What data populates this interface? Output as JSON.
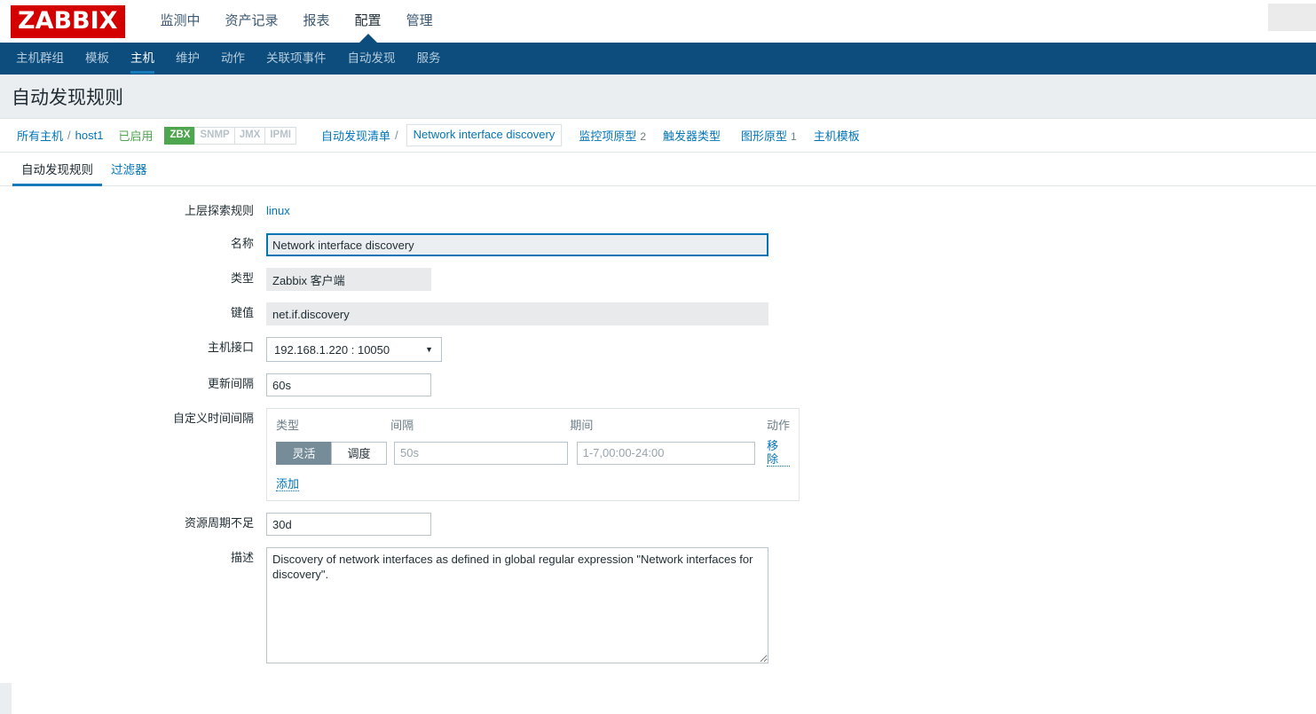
{
  "header": {
    "logo": "ZABBIX",
    "menu": [
      {
        "label": "监测中",
        "selected": false
      },
      {
        "label": "资产记录",
        "selected": false
      },
      {
        "label": "报表",
        "selected": false
      },
      {
        "label": "配置",
        "selected": true
      },
      {
        "label": "管理",
        "selected": false
      }
    ],
    "accent_color": "#d40000",
    "nav_color": "#0c4d7e"
  },
  "subnav": {
    "items": [
      {
        "label": "主机群组",
        "selected": false
      },
      {
        "label": "模板",
        "selected": false
      },
      {
        "label": "主机",
        "selected": true
      },
      {
        "label": "维护",
        "selected": false
      },
      {
        "label": "动作",
        "selected": false
      },
      {
        "label": "关联项事件",
        "selected": false
      },
      {
        "label": "自动发现",
        "selected": false
      },
      {
        "label": "服务",
        "selected": false
      }
    ]
  },
  "page": {
    "title": "自动发现规则"
  },
  "breadcrumb": {
    "all_hosts": "所有主机",
    "separator": "/",
    "host": "host1",
    "status": "已启用",
    "status_color": "#4ea64e",
    "interfaces": [
      {
        "label": "ZBX",
        "active": true
      },
      {
        "label": "SNMP",
        "active": false
      },
      {
        "label": "JMX",
        "active": false
      },
      {
        "label": "IPMI",
        "active": false
      }
    ],
    "discovery_list": "自动发现清单",
    "current": "Network interface discovery",
    "links": [
      {
        "label": "监控项原型",
        "count": "2"
      },
      {
        "label": "触发器类型",
        "count": ""
      },
      {
        "label": "图形原型",
        "count": "1"
      },
      {
        "label": "主机模板",
        "count": ""
      }
    ]
  },
  "tabs": [
    {
      "label": "自动发现规则",
      "selected": true
    },
    {
      "label": "过滤器",
      "selected": false
    }
  ],
  "form": {
    "parent_rule": {
      "label": "上层探索规则",
      "value": "linux"
    },
    "name": {
      "label": "名称",
      "value": "Network interface discovery"
    },
    "type": {
      "label": "类型",
      "value": "Zabbix 客户端"
    },
    "key": {
      "label": "键值",
      "value": "net.if.discovery"
    },
    "host_interface": {
      "label": "主机接口",
      "value": "192.168.1.220 : 10050",
      "arrow": "▼"
    },
    "update_interval": {
      "label": "更新间隔",
      "value": "60s"
    },
    "custom_intervals": {
      "label": "自定义时间间隔",
      "columns": {
        "type": "类型",
        "interval": "间隔",
        "period": "期间",
        "action": "动作"
      },
      "rows": [
        {
          "type_flexible": "灵活",
          "type_scheduling": "调度",
          "type_selected": "灵活",
          "interval_value": "",
          "interval_placeholder": "50s",
          "period_value": "",
          "period_placeholder": "1-7,00:00-24:00",
          "action": "移除"
        }
      ],
      "add_label": "添加"
    },
    "lifetime": {
      "label": "资源周期不足",
      "value": "30d"
    },
    "description": {
      "label": "描述",
      "value": "Discovery of network interfaces as defined in global regular expression \"Network interfaces for discovery\"."
    }
  }
}
